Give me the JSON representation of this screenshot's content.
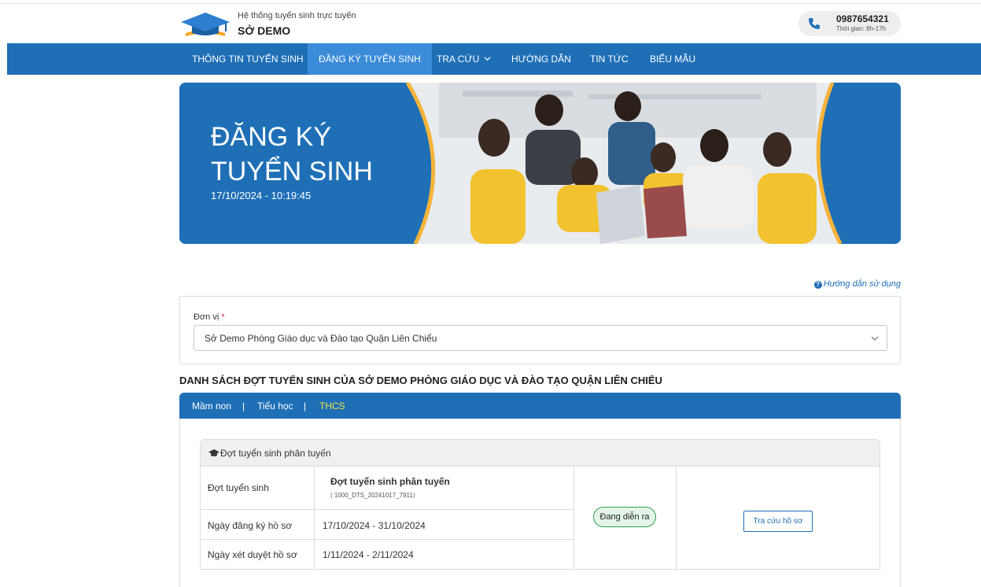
{
  "header": {
    "subtitle": "Hệ thống tuyển sinh trực tuyến",
    "title": "SỞ DEMO",
    "hotline": {
      "number": "0987654321",
      "hours": "Thời gian: 8h-17h"
    }
  },
  "nav": {
    "items": [
      {
        "label": "THÔNG TIN TUYỂN SINH",
        "active": false
      },
      {
        "label": "ĐĂNG KÝ TUYỂN SINH",
        "active": true
      },
      {
        "label": "TRA CỨU",
        "active": false,
        "dropdown": true
      },
      {
        "label": "HƯỚNG DẪN",
        "active": false
      },
      {
        "label": "TIN TỨC",
        "active": false
      },
      {
        "label": "BIỂU MẪU",
        "active": false
      }
    ]
  },
  "banner": {
    "title_line1": "ĐĂNG KÝ",
    "title_line2": "TUYỂN SINH",
    "datetime": "17/10/2024 - 10:19:45"
  },
  "help_link": "Hướng dẫn sử dụng",
  "unit": {
    "label": "Đơn vị",
    "required_mark": "*",
    "selected": "Sở Demo Phòng Giáo dục và Đào tạo Quận Liên Chiểu"
  },
  "list_title": "DANH SÁCH ĐỢT TUYỂN SINH CỦA SỞ DEMO PHÒNG GIÁO DỤC VÀ ĐÀO TẠO QUẬN LIÊN CHIỂU",
  "tabs": {
    "items": [
      {
        "label": "Mầm non",
        "active": false
      },
      {
        "label": "Tiểu học",
        "active": false
      },
      {
        "label": "THCS",
        "active": true
      }
    ],
    "separator": "|"
  },
  "round": {
    "header": "Đợt tuyển sinh phân tuyến",
    "rows": {
      "round_label": "Đợt tuyển sinh",
      "round_name": "Đợt tuyển sinh phân tuyến",
      "round_code": "( 1000_DTS_20241017_7911)",
      "register_label": "Ngày đăng ký hồ sơ",
      "register_dates": "17/10/2024 - 31/10/2024",
      "review_label": "Ngày xét duyệt hồ sơ",
      "review_dates": "1/11/2024 - 2/11/2024"
    },
    "status": "Đang diễn ra",
    "action_label": "Tra cứu hồ sơ"
  },
  "colors": {
    "primary": "#1f6fb7",
    "active_nav": "#3a8bd8",
    "active_tab": "#f0e442",
    "status_border": "#2e9e4f",
    "banner_accent": "#f4b43a"
  }
}
